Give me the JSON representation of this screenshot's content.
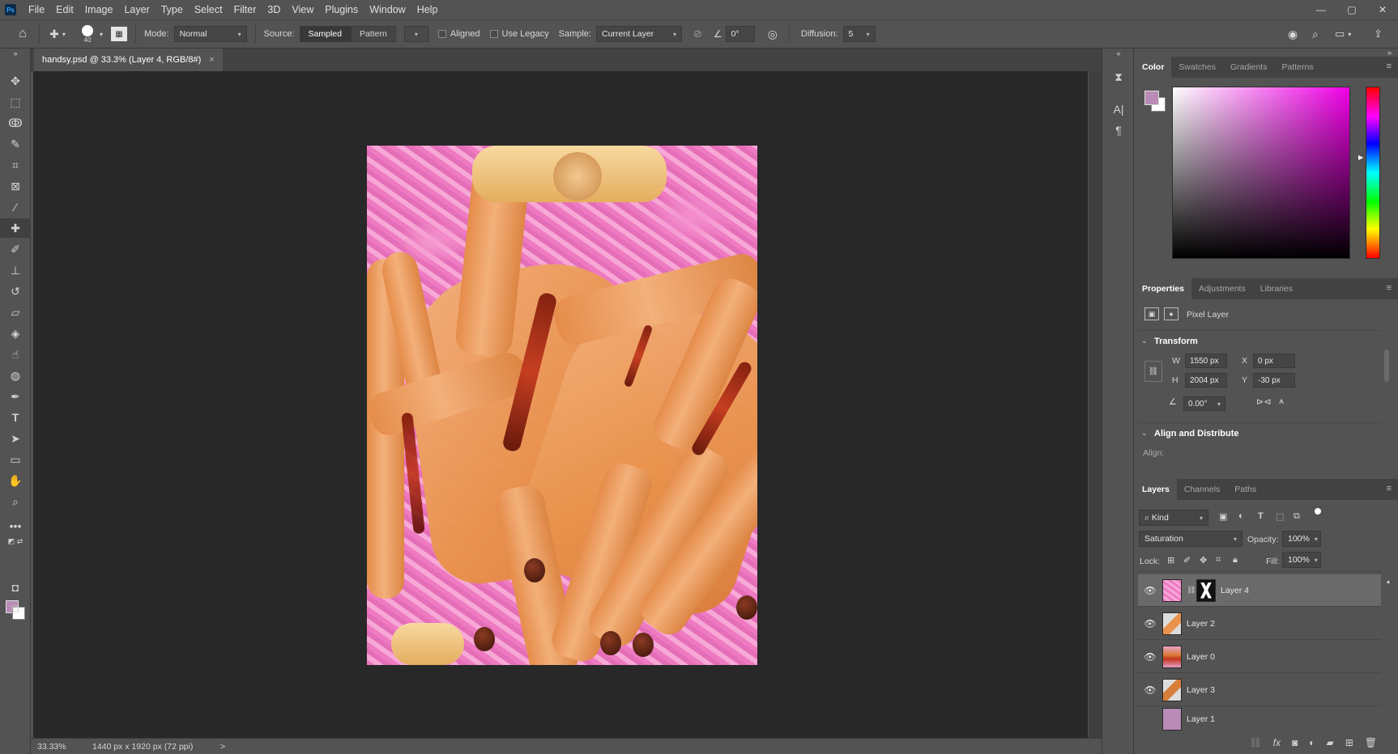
{
  "menubar": {
    "logo": "Ps",
    "items": [
      "File",
      "Edit",
      "Image",
      "Layer",
      "Type",
      "Select",
      "Filter",
      "3D",
      "View",
      "Plugins",
      "Window",
      "Help"
    ]
  },
  "options": {
    "brush_size": "40",
    "mode_label": "Mode:",
    "mode_value": "Normal",
    "source_label": "Source:",
    "source_sampled": "Sampled",
    "source_pattern": "Pattern",
    "aligned_label": "Aligned",
    "use_legacy_label": "Use Legacy",
    "sample_label": "Sample:",
    "sample_value": "Current Layer",
    "angle_value": "0°",
    "diffusion_label": "Diffusion:",
    "diffusion_value": "5"
  },
  "document": {
    "tab_title": "handsy.psd @ 33.3% (Layer 4, RGB/8#)",
    "close_glyph": "×"
  },
  "status": {
    "zoom": "33.33%",
    "dimensions": "1440 px x 1920 px (72 ppi)",
    "arrow": ">"
  },
  "color_panel": {
    "tabs": [
      "Color",
      "Swatches",
      "Gradients",
      "Patterns"
    ],
    "foreground": "#b98bb6",
    "background": "#ffffff"
  },
  "properties_panel": {
    "tabs": [
      "Properties",
      "Adjustments",
      "Libraries"
    ],
    "kind": "Pixel Layer",
    "transform_title": "Transform",
    "w_label": "W",
    "w_value": "1550 px",
    "h_label": "H",
    "h_value": "2004 px",
    "x_label": "X",
    "x_value": "0 px",
    "y_label": "Y",
    "y_value": "-30 px",
    "angle_value": "0.00°",
    "align_title": "Align and Distribute",
    "align_label": "Align:"
  },
  "layers_panel": {
    "tabs": [
      "Layers",
      "Channels",
      "Paths"
    ],
    "filter_kind": "Kind",
    "blend_mode": "Saturation",
    "opacity_label": "Opacity:",
    "opacity_value": "100%",
    "lock_label": "Lock:",
    "fill_label": "Fill:",
    "fill_value": "100%",
    "layers": [
      {
        "name": "Layer 4",
        "visible": true,
        "selected": true
      },
      {
        "name": "Layer 2",
        "visible": true,
        "selected": false
      },
      {
        "name": "Layer 0",
        "visible": true,
        "selected": false
      },
      {
        "name": "Layer 3",
        "visible": true,
        "selected": false
      },
      {
        "name": "Layer 1",
        "visible": false,
        "selected": false
      }
    ]
  }
}
